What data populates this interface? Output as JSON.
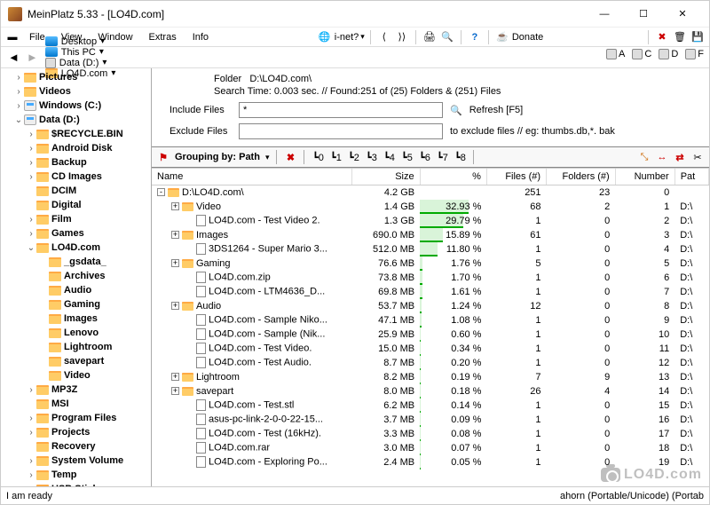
{
  "window": {
    "title": "MeinPlatz 5.33 - [LO4D.com]"
  },
  "menubar": {
    "items": [
      "File",
      "View",
      "Window",
      "Extras",
      "Info"
    ],
    "inet": "i-net?",
    "donate": "Donate"
  },
  "breadcrumbs": [
    {
      "icon": "monitor",
      "label": "Desktop"
    },
    {
      "icon": "monitor",
      "label": "This PC"
    },
    {
      "icon": "drive",
      "label": "Data (D:)"
    },
    {
      "icon": "folder",
      "label": "LO4D.com"
    }
  ],
  "drives": [
    "A",
    "C",
    "D",
    "F"
  ],
  "tree": [
    {
      "indent": 1,
      "exp": ">",
      "icon": "folder",
      "label": "Pictures",
      "bold": true
    },
    {
      "indent": 1,
      "exp": ">",
      "icon": "folder",
      "label": "Videos",
      "bold": true
    },
    {
      "indent": 1,
      "exp": ">",
      "icon": "drive",
      "label": "Windows (C:)",
      "bold": true
    },
    {
      "indent": 1,
      "exp": "v",
      "icon": "drive",
      "label": "Data (D:)",
      "bold": true
    },
    {
      "indent": 2,
      "exp": ">",
      "icon": "folder",
      "label": "$RECYCLE.BIN",
      "bold": true
    },
    {
      "indent": 2,
      "exp": ">",
      "icon": "folder",
      "label": "Android Disk",
      "bold": true
    },
    {
      "indent": 2,
      "exp": ">",
      "icon": "folder",
      "label": "Backup",
      "bold": true
    },
    {
      "indent": 2,
      "exp": ">",
      "icon": "folder",
      "label": "CD Images",
      "bold": true
    },
    {
      "indent": 2,
      "exp": "",
      "icon": "folder",
      "label": "DCIM",
      "bold": true
    },
    {
      "indent": 2,
      "exp": "",
      "icon": "folder",
      "label": "Digital",
      "bold": true
    },
    {
      "indent": 2,
      "exp": ">",
      "icon": "folder",
      "label": "Film",
      "bold": true
    },
    {
      "indent": 2,
      "exp": ">",
      "icon": "folder",
      "label": "Games",
      "bold": true
    },
    {
      "indent": 2,
      "exp": "v",
      "icon": "folder",
      "label": "LO4D.com",
      "bold": true
    },
    {
      "indent": 3,
      "exp": "",
      "icon": "folder",
      "label": "_gsdata_",
      "bold": true
    },
    {
      "indent": 3,
      "exp": "",
      "icon": "folder",
      "label": "Archives",
      "bold": true
    },
    {
      "indent": 3,
      "exp": "",
      "icon": "folder",
      "label": "Audio",
      "bold": true
    },
    {
      "indent": 3,
      "exp": "",
      "icon": "folder",
      "label": "Gaming",
      "bold": true
    },
    {
      "indent": 3,
      "exp": "",
      "icon": "folder",
      "label": "Images",
      "bold": true
    },
    {
      "indent": 3,
      "exp": "",
      "icon": "folder",
      "label": "Lenovo",
      "bold": true
    },
    {
      "indent": 3,
      "exp": "",
      "icon": "folder",
      "label": "Lightroom",
      "bold": true
    },
    {
      "indent": 3,
      "exp": "",
      "icon": "folder",
      "label": "savepart",
      "bold": true
    },
    {
      "indent": 3,
      "exp": "",
      "icon": "folder",
      "label": "Video",
      "bold": true
    },
    {
      "indent": 2,
      "exp": ">",
      "icon": "folder",
      "label": "MP3Z",
      "bold": true
    },
    {
      "indent": 2,
      "exp": "",
      "icon": "folder",
      "label": "MSI",
      "bold": true
    },
    {
      "indent": 2,
      "exp": ">",
      "icon": "folder",
      "label": "Program Files",
      "bold": true
    },
    {
      "indent": 2,
      "exp": ">",
      "icon": "folder",
      "label": "Projects",
      "bold": true
    },
    {
      "indent": 2,
      "exp": "",
      "icon": "folder",
      "label": "Recovery",
      "bold": true
    },
    {
      "indent": 2,
      "exp": ">",
      "icon": "folder",
      "label": "System Volume",
      "bold": true
    },
    {
      "indent": 2,
      "exp": ">",
      "icon": "folder",
      "label": "Temp",
      "bold": true
    },
    {
      "indent": 2,
      "exp": ">",
      "icon": "folder",
      "label": "USB Stick",
      "bold": true
    }
  ],
  "info": {
    "folder_label": "Folder",
    "folder_path": "D:\\LO4D.com\\",
    "search_line": "Search Time: 0.003 sec.  //  Found:251 of (25) Folders & (251) Files",
    "include_label": "Include Files",
    "include_value": "*",
    "exclude_label": "Exclude Files",
    "exclude_value": "",
    "refresh": "Refresh [F5]",
    "exclude_hint": "to exclude files // eg: thumbs.db,*. bak"
  },
  "grouping": {
    "label": "Grouping by: Path"
  },
  "columns": [
    "Name",
    "Size",
    "%",
    "Files (#)",
    "Folders (#)",
    "Number",
    "Pat"
  ],
  "rows": [
    {
      "indent": 0,
      "exp": "-",
      "type": "folder",
      "name": "D:\\LO4D.com\\",
      "size": "4.2 GB",
      "pct": "",
      "pctv": 0,
      "files": "251",
      "folders": "23",
      "num": "0",
      "path": ""
    },
    {
      "indent": 1,
      "exp": "+",
      "type": "folder",
      "name": "Video",
      "size": "1.4 GB",
      "pct": "32.93 %",
      "pctv": 32.93,
      "files": "68",
      "folders": "2",
      "num": "1",
      "path": "D:\\"
    },
    {
      "indent": 2,
      "exp": "",
      "type": "file",
      "name": "LO4D.com - Test Video 2.",
      "size": "1.3 GB",
      "pct": "29.79 %",
      "pctv": 29.79,
      "files": "1",
      "folders": "0",
      "num": "2",
      "path": "D:\\"
    },
    {
      "indent": 1,
      "exp": "+",
      "type": "folder",
      "name": "Images",
      "size": "690.0 MB",
      "pct": "15.89 %",
      "pctv": 15.89,
      "files": "61",
      "folders": "0",
      "num": "3",
      "path": "D:\\"
    },
    {
      "indent": 2,
      "exp": "",
      "type": "file",
      "name": "3DS1264 - Super Mario 3...",
      "size": "512.0 MB",
      "pct": "11.80 %",
      "pctv": 11.8,
      "files": "1",
      "folders": "0",
      "num": "4",
      "path": "D:\\"
    },
    {
      "indent": 1,
      "exp": "+",
      "type": "folder",
      "name": "Gaming",
      "size": "76.6 MB",
      "pct": "1.76 %",
      "pctv": 1.76,
      "files": "5",
      "folders": "0",
      "num": "5",
      "path": "D:\\"
    },
    {
      "indent": 2,
      "exp": "",
      "type": "file",
      "name": "LO4D.com.zip",
      "size": "73.8 MB",
      "pct": "1.70 %",
      "pctv": 1.7,
      "files": "1",
      "folders": "0",
      "num": "6",
      "path": "D:\\"
    },
    {
      "indent": 2,
      "exp": "",
      "type": "file",
      "name": "LO4D.com - LTM4636_D...",
      "size": "69.8 MB",
      "pct": "1.61 %",
      "pctv": 1.61,
      "files": "1",
      "folders": "0",
      "num": "7",
      "path": "D:\\"
    },
    {
      "indent": 1,
      "exp": "+",
      "type": "folder",
      "name": "Audio",
      "size": "53.7 MB",
      "pct": "1.24 %",
      "pctv": 1.24,
      "files": "12",
      "folders": "0",
      "num": "8",
      "path": "D:\\"
    },
    {
      "indent": 2,
      "exp": "",
      "type": "file",
      "name": "LO4D.com - Sample Niko...",
      "size": "47.1 MB",
      "pct": "1.08 %",
      "pctv": 1.08,
      "files": "1",
      "folders": "0",
      "num": "9",
      "path": "D:\\"
    },
    {
      "indent": 2,
      "exp": "",
      "type": "file",
      "name": "LO4D.com - Sample (Nik...",
      "size": "25.9 MB",
      "pct": "0.60 %",
      "pctv": 0.6,
      "files": "1",
      "folders": "0",
      "num": "10",
      "path": "D:\\"
    },
    {
      "indent": 2,
      "exp": "",
      "type": "file",
      "name": "LO4D.com - Test Video.",
      "size": "15.0 MB",
      "pct": "0.34 %",
      "pctv": 0.34,
      "files": "1",
      "folders": "0",
      "num": "11",
      "path": "D:\\"
    },
    {
      "indent": 2,
      "exp": "",
      "type": "file",
      "name": "LO4D.com - Test Audio.",
      "size": "8.7 MB",
      "pct": "0.20 %",
      "pctv": 0.2,
      "files": "1",
      "folders": "0",
      "num": "12",
      "path": "D:\\"
    },
    {
      "indent": 1,
      "exp": "+",
      "type": "folder",
      "name": "Lightroom",
      "size": "8.2 MB",
      "pct": "0.19 %",
      "pctv": 0.19,
      "files": "7",
      "folders": "9",
      "num": "13",
      "path": "D:\\"
    },
    {
      "indent": 1,
      "exp": "+",
      "type": "folder",
      "name": "savepart",
      "size": "8.0 MB",
      "pct": "0.18 %",
      "pctv": 0.18,
      "files": "26",
      "folders": "4",
      "num": "14",
      "path": "D:\\"
    },
    {
      "indent": 2,
      "exp": "",
      "type": "file",
      "name": "LO4D.com - Test.stl",
      "size": "6.2 MB",
      "pct": "0.14 %",
      "pctv": 0.14,
      "files": "1",
      "folders": "0",
      "num": "15",
      "path": "D:\\"
    },
    {
      "indent": 2,
      "exp": "",
      "type": "file",
      "name": "asus-pc-link-2-0-0-22-15...",
      "size": "3.7 MB",
      "pct": "0.09 %",
      "pctv": 0.09,
      "files": "1",
      "folders": "0",
      "num": "16",
      "path": "D:\\"
    },
    {
      "indent": 2,
      "exp": "",
      "type": "file",
      "name": "LO4D.com - Test (16kHz).",
      "size": "3.3 MB",
      "pct": "0.08 %",
      "pctv": 0.08,
      "files": "1",
      "folders": "0",
      "num": "17",
      "path": "D:\\"
    },
    {
      "indent": 2,
      "exp": "",
      "type": "file",
      "name": "LO4D.com.rar",
      "size": "3.0 MB",
      "pct": "0.07 %",
      "pctv": 0.07,
      "files": "1",
      "folders": "0",
      "num": "18",
      "path": "D:\\"
    },
    {
      "indent": 2,
      "exp": "",
      "type": "file",
      "name": "LO4D.com - Exploring Po...",
      "size": "2.4 MB",
      "pct": "0.05 %",
      "pctv": 0.05,
      "files": "1",
      "folders": "0",
      "num": "19",
      "path": "D:\\"
    }
  ],
  "status": {
    "left": "I am ready",
    "right": "ahorn (Portable/Unicode) (Portab"
  },
  "watermark": "LO4D.com"
}
